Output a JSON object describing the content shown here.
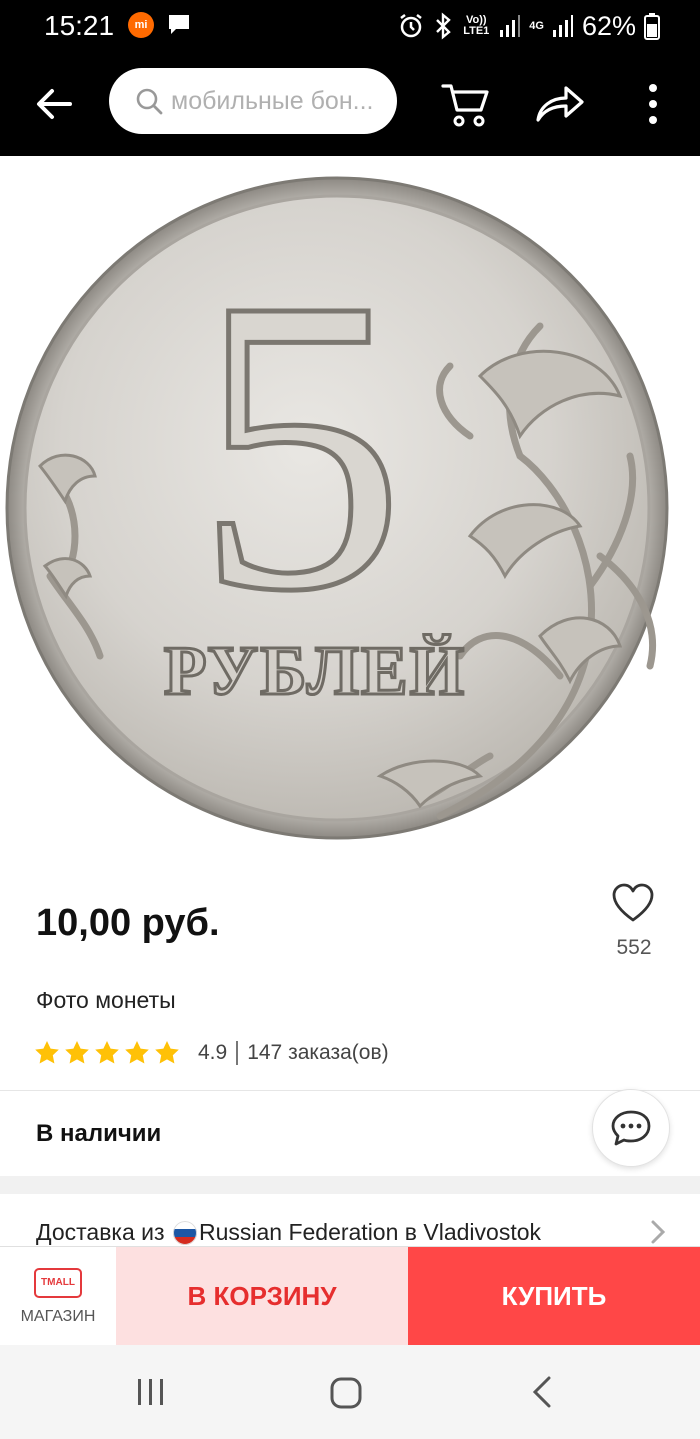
{
  "status_bar": {
    "time": "15:21",
    "network_lte": "Vo)) LTE1",
    "network_4g": "4G",
    "battery": "62%"
  },
  "header": {
    "search_placeholder": "мобильные бон...",
    "icons": [
      "back-arrow-icon",
      "search-icon",
      "cart-icon",
      "share-icon",
      "more-vertical-icon"
    ]
  },
  "product": {
    "image_text": {
      "denomination": "5",
      "currency": "РУБЛЕЙ"
    },
    "price": "10,00 руб.",
    "favorites_count": "552",
    "title": "Фото монеты",
    "rating": "4.9",
    "stars": 5,
    "orders": "147 заказа(ов)",
    "stock_status": "В наличии"
  },
  "delivery": {
    "prefix": "Доставка из ",
    "route": "Russian Federation в Vladivostok"
  },
  "action_bar": {
    "store_logo": "TMALL",
    "store_label": "МАГАЗИН",
    "add_to_cart_label": "В КОРЗИНУ",
    "buy_label": "КУПИТЬ"
  },
  "colors": {
    "accent_red": "#ff4747",
    "cart_bg": "#fde0e0",
    "cart_text": "#e62e2e",
    "star": "#ffc107"
  }
}
